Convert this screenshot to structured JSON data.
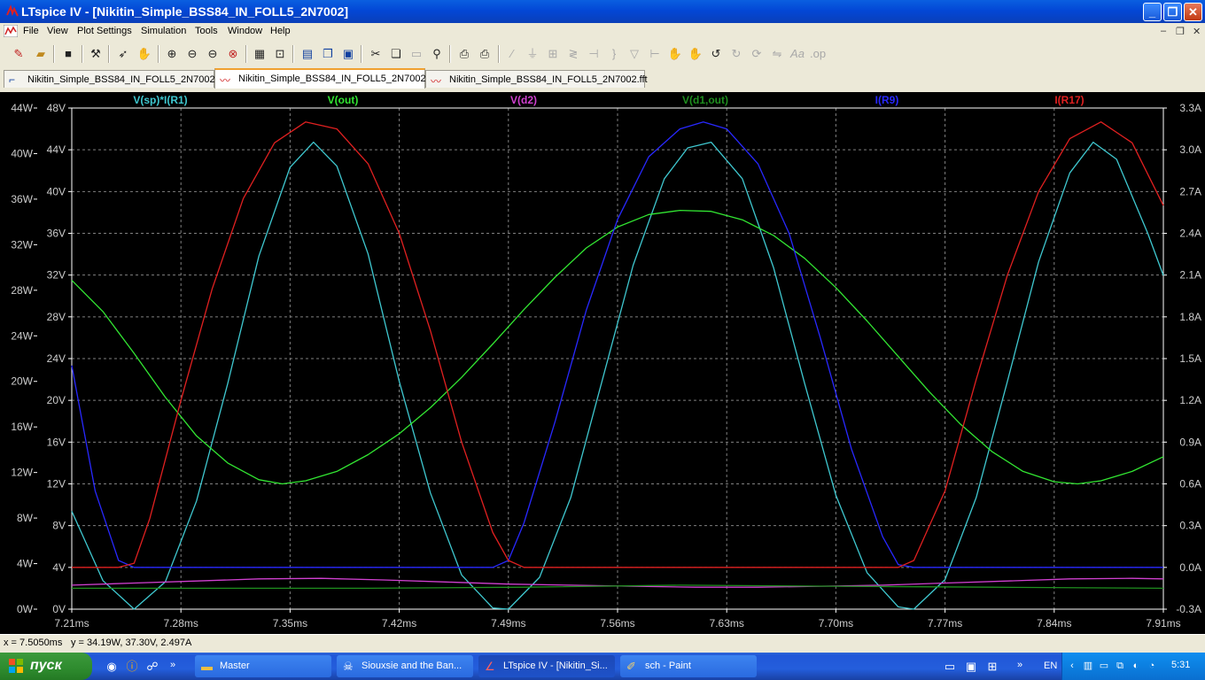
{
  "window": {
    "title": "LTspice IV - [Nikitin_Simple_BSS84_IN_FOLL5_2N7002]",
    "controls": {
      "minimize": "_",
      "maximize": "❐",
      "close": "✕"
    }
  },
  "menu": [
    "File",
    "View",
    "Plot Settings",
    "Simulation",
    "Tools",
    "Window",
    "Help"
  ],
  "mdi_controls": {
    "minimize": "–",
    "restore": "❐",
    "close": "✕"
  },
  "toolbar": {
    "icons": [
      "close-schematic-icon",
      "open-icon",
      "save-icon",
      "control-panel-icon",
      "run-icon",
      "halt-icon",
      "zoom-in-icon",
      "zoom-out-icon",
      "zoom-back-icon",
      "zoom-cancel-icon",
      "autorange-icon",
      "fit-icon",
      "tile-horizontal-icon",
      "cascade-icon",
      "tile-icon",
      "cut-icon",
      "copy-icon",
      "paste-icon",
      "find-icon",
      "print-setup-icon",
      "print-icon",
      "wire-icon",
      "ground-icon",
      "label-icon",
      "resistor-icon",
      "capacitor-icon",
      "inductor-icon",
      "diode-icon",
      "hand-icon",
      "drag-icon",
      "undo-icon",
      "redo-icon",
      "rotate-icon",
      "mirror-icon",
      "text-icon",
      "spice-directive-icon"
    ]
  },
  "tabs": [
    {
      "label": "Nikitin_Simple_BSS84_IN_FOLL5_2N7002",
      "icon": "schematic-icon",
      "active": false
    },
    {
      "label": "Nikitin_Simple_BSS84_IN_FOLL5_2N7002",
      "icon": "waveform-icon",
      "active": true
    },
    {
      "label": "Nikitin_Simple_BSS84_IN_FOLL5_2N7002.fft",
      "icon": "waveform-icon",
      "active": false
    }
  ],
  "plot": {
    "background": "#000000",
    "grid_color": "#808080",
    "axis_label_color": "#cccccc"
  },
  "chart_data": {
    "type": "line",
    "grid": true,
    "xlabel_unit": "ms",
    "xlim": [
      7.21,
      7.91
    ],
    "x_ticks": [
      "7.21ms",
      "7.28ms",
      "7.35ms",
      "7.42ms",
      "7.49ms",
      "7.56ms",
      "7.63ms",
      "7.70ms",
      "7.77ms",
      "7.84ms",
      "7.91ms"
    ],
    "y_axes": {
      "power_left": {
        "range": [
          0,
          44
        ],
        "ticks": [
          "0W",
          "4W",
          "8W",
          "12W",
          "16W",
          "20W",
          "24W",
          "28W",
          "32W",
          "36W",
          "40W",
          "44W"
        ]
      },
      "voltage": {
        "range": [
          0,
          48
        ],
        "ticks": [
          "0V",
          "4V",
          "8V",
          "12V",
          "16V",
          "20V",
          "24V",
          "28V",
          "32V",
          "36V",
          "40V",
          "44V",
          "48V"
        ]
      },
      "current_right": {
        "range": [
          -0.3,
          3.3
        ],
        "ticks": [
          "-0.3A",
          "0.0A",
          "0.3A",
          "0.6A",
          "0.9A",
          "1.2A",
          "1.5A",
          "1.8A",
          "2.1A",
          "2.4A",
          "2.7A",
          "3.0A",
          "3.3A"
        ]
      }
    },
    "series": [
      {
        "name": "V(sp)*I(R1)",
        "color": "#3fc8d0",
        "axis": "power_left",
        "points": [
          [
            7.21,
            8.6
          ],
          [
            7.23,
            2.5
          ],
          [
            7.25,
            0.0
          ],
          [
            7.27,
            2.4
          ],
          [
            7.29,
            9.5
          ],
          [
            7.31,
            19.8
          ],
          [
            7.33,
            31.0
          ],
          [
            7.35,
            38.8
          ],
          [
            7.365,
            41.0
          ],
          [
            7.38,
            38.9
          ],
          [
            7.4,
            31.2
          ],
          [
            7.42,
            20.0
          ],
          [
            7.44,
            10.2
          ],
          [
            7.46,
            3.0
          ],
          [
            7.48,
            0.1
          ],
          [
            7.49,
            0.0
          ],
          [
            7.51,
            2.8
          ],
          [
            7.53,
            9.8
          ],
          [
            7.55,
            20.0
          ],
          [
            7.57,
            30.2
          ],
          [
            7.59,
            37.8
          ],
          [
            7.605,
            40.5
          ],
          [
            7.62,
            41.0
          ],
          [
            7.64,
            37.8
          ],
          [
            7.66,
            30.0
          ],
          [
            7.68,
            19.8
          ],
          [
            7.7,
            10.0
          ],
          [
            7.72,
            3.2
          ],
          [
            7.74,
            0.2
          ],
          [
            7.75,
            0.0
          ],
          [
            7.77,
            2.6
          ],
          [
            7.79,
            9.8
          ],
          [
            7.81,
            20.0
          ],
          [
            7.83,
            30.5
          ],
          [
            7.85,
            38.3
          ],
          [
            7.865,
            41.0
          ],
          [
            7.88,
            39.5
          ],
          [
            7.9,
            33.0
          ],
          [
            7.91,
            29.3
          ]
        ]
      },
      {
        "name": "V(out)",
        "color": "#32e632",
        "axis": "voltage",
        "points": [
          [
            7.21,
            31.5
          ],
          [
            7.23,
            28.5
          ],
          [
            7.25,
            24.5
          ],
          [
            7.27,
            20.3
          ],
          [
            7.29,
            16.6
          ],
          [
            7.31,
            14.0
          ],
          [
            7.33,
            12.4
          ],
          [
            7.345,
            12.0
          ],
          [
            7.36,
            12.3
          ],
          [
            7.38,
            13.2
          ],
          [
            7.4,
            14.8
          ],
          [
            7.42,
            16.8
          ],
          [
            7.44,
            19.3
          ],
          [
            7.46,
            22.2
          ],
          [
            7.48,
            25.4
          ],
          [
            7.5,
            28.7
          ],
          [
            7.52,
            31.8
          ],
          [
            7.54,
            34.6
          ],
          [
            7.56,
            36.6
          ],
          [
            7.58,
            37.8
          ],
          [
            7.6,
            38.2
          ],
          [
            7.62,
            38.1
          ],
          [
            7.64,
            37.3
          ],
          [
            7.66,
            35.8
          ],
          [
            7.68,
            33.6
          ],
          [
            7.7,
            30.8
          ],
          [
            7.72,
            27.6
          ],
          [
            7.74,
            24.2
          ],
          [
            7.76,
            20.8
          ],
          [
            7.78,
            17.7
          ],
          [
            7.8,
            15.1
          ],
          [
            7.82,
            13.2
          ],
          [
            7.84,
            12.2
          ],
          [
            7.855,
            12.0
          ],
          [
            7.87,
            12.3
          ],
          [
            7.89,
            13.2
          ],
          [
            7.91,
            14.6
          ]
        ]
      },
      {
        "name": "V(d2)",
        "color": "#d040d0",
        "axis": "voltage",
        "points": [
          [
            7.21,
            2.3
          ],
          [
            7.25,
            2.5
          ],
          [
            7.29,
            2.7
          ],
          [
            7.33,
            2.9
          ],
          [
            7.37,
            2.95
          ],
          [
            7.41,
            2.8
          ],
          [
            7.45,
            2.6
          ],
          [
            7.49,
            2.4
          ],
          [
            7.53,
            2.3
          ],
          [
            7.57,
            2.2
          ],
          [
            7.61,
            2.1
          ],
          [
            7.65,
            2.1
          ],
          [
            7.69,
            2.2
          ],
          [
            7.73,
            2.3
          ],
          [
            7.77,
            2.5
          ],
          [
            7.81,
            2.7
          ],
          [
            7.85,
            2.9
          ],
          [
            7.89,
            2.95
          ],
          [
            7.91,
            2.9
          ]
        ]
      },
      {
        "name": "V(d1,out)",
        "color": "#1f8f1f",
        "axis": "voltage",
        "points": [
          [
            7.21,
            2.0
          ],
          [
            7.3,
            2.0
          ],
          [
            7.4,
            2.0
          ],
          [
            7.5,
            2.1
          ],
          [
            7.6,
            2.3
          ],
          [
            7.7,
            2.2
          ],
          [
            7.8,
            2.1
          ],
          [
            7.91,
            2.0
          ]
        ]
      },
      {
        "name": "I(R9)",
        "color": "#2828ff",
        "axis": "current_right",
        "points": [
          [
            7.21,
            1.45
          ],
          [
            7.225,
            0.55
          ],
          [
            7.24,
            0.05
          ],
          [
            7.25,
            0.0
          ],
          [
            7.3,
            0.0
          ],
          [
            7.4,
            0.0
          ],
          [
            7.48,
            0.0
          ],
          [
            7.49,
            0.05
          ],
          [
            7.5,
            0.32
          ],
          [
            7.52,
            1.05
          ],
          [
            7.54,
            1.85
          ],
          [
            7.56,
            2.5
          ],
          [
            7.58,
            2.95
          ],
          [
            7.6,
            3.15
          ],
          [
            7.615,
            3.2
          ],
          [
            7.63,
            3.15
          ],
          [
            7.65,
            2.9
          ],
          [
            7.67,
            2.4
          ],
          [
            7.69,
            1.65
          ],
          [
            7.71,
            0.85
          ],
          [
            7.73,
            0.22
          ],
          [
            7.74,
            0.02
          ],
          [
            7.75,
            0.0
          ],
          [
            7.8,
            0.0
          ],
          [
            7.91,
            0.0
          ]
        ]
      },
      {
        "name": "I(R17)",
        "color": "#e02020",
        "axis": "current_right",
        "points": [
          [
            7.21,
            0.0
          ],
          [
            7.24,
            0.0
          ],
          [
            7.25,
            0.03
          ],
          [
            7.26,
            0.35
          ],
          [
            7.28,
            1.2
          ],
          [
            7.3,
            2.0
          ],
          [
            7.32,
            2.65
          ],
          [
            7.34,
            3.05
          ],
          [
            7.36,
            3.2
          ],
          [
            7.38,
            3.15
          ],
          [
            7.4,
            2.9
          ],
          [
            7.42,
            2.4
          ],
          [
            7.44,
            1.7
          ],
          [
            7.46,
            0.9
          ],
          [
            7.48,
            0.25
          ],
          [
            7.49,
            0.05
          ],
          [
            7.5,
            0.0
          ],
          [
            7.6,
            0.0
          ],
          [
            7.7,
            0.0
          ],
          [
            7.74,
            0.0
          ],
          [
            7.75,
            0.05
          ],
          [
            7.77,
            0.55
          ],
          [
            7.79,
            1.35
          ],
          [
            7.81,
            2.1
          ],
          [
            7.83,
            2.7
          ],
          [
            7.85,
            3.08
          ],
          [
            7.87,
            3.2
          ],
          [
            7.89,
            3.05
          ],
          [
            7.91,
            2.6
          ]
        ]
      }
    ]
  },
  "status": {
    "x": "x = 7.5050ms",
    "y": "y = 34.19W, 37.30V, 2.497A"
  },
  "taskbar": {
    "start_label": "пуск",
    "tasks": [
      {
        "label": "Master",
        "icon": "folder-icon",
        "active": false
      },
      {
        "label": "Siouxsie and the Ban...",
        "icon": "media-icon",
        "active": false
      },
      {
        "label": "LTspice IV - [Nikitin_Si...",
        "icon": "ltspice-icon",
        "active": true
      },
      {
        "label": "sch - Paint",
        "icon": "paint-icon",
        "active": false
      }
    ],
    "language": "EN",
    "clock": "5:31"
  }
}
